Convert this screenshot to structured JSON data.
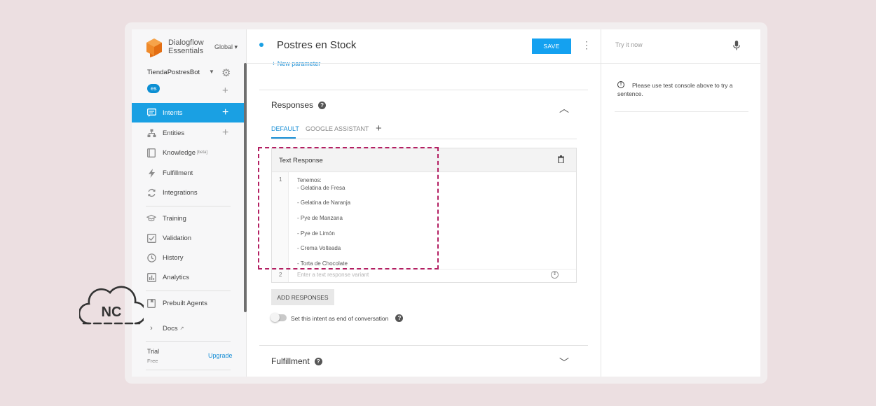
{
  "brand": {
    "name_line1": "Dialogflow",
    "name_line2": "Essentials",
    "region": "Global ▾",
    "accent": "#1aa0e3",
    "highlight": "#b31f62"
  },
  "agent": {
    "name": "TiendaPostresBot",
    "language": "es"
  },
  "sidebar": {
    "items": [
      {
        "label": "Intents",
        "icon": "intents-icon"
      },
      {
        "label": "Entities",
        "icon": "entities-icon"
      },
      {
        "label": "Knowledge",
        "badge": "[beta]",
        "icon": "knowledge-icon"
      },
      {
        "label": "Fulfillment",
        "icon": "fulfillment-icon"
      },
      {
        "label": "Integrations",
        "icon": "integrations-icon"
      },
      {
        "label": "Training",
        "icon": "training-icon"
      },
      {
        "label": "Validation",
        "icon": "validation-icon"
      },
      {
        "label": "History",
        "icon": "history-icon"
      },
      {
        "label": "Analytics",
        "icon": "analytics-icon"
      },
      {
        "label": "Prebuilt Agents",
        "icon": "prebuilt-agents-icon"
      },
      {
        "label": "Docs",
        "icon": "docs-icon"
      }
    ],
    "trial": "Trial",
    "trial_sub": "Free",
    "upgrade": "Upgrade"
  },
  "header": {
    "title": "Postres en Stock",
    "save_label": "SAVE"
  },
  "main": {
    "new_parameter": "+ New parameter",
    "responses_title": "Responses",
    "tabs": [
      "DEFAULT",
      "GOOGLE ASSISTANT"
    ],
    "text_response": {
      "title": "Text Response",
      "line_numbers": [
        "1",
        "2"
      ],
      "lines": [
        "Tenemos:",
        "- Gelatina de Fresa",
        "",
        "- Gelatina de Naranja",
        "",
        "- Pye de Manzana",
        "",
        "- Pye de Limón",
        "",
        "- Crema Volteada",
        "",
        "- Torta de Chocolate"
      ],
      "variant_placeholder": "Enter a text response variant"
    },
    "add_responses": "ADD RESPONSES",
    "end_conversation_label": "Set this intent as end of conversation",
    "fulfillment_title": "Fulfillment"
  },
  "test_console": {
    "placeholder": "Try it now",
    "info": "Please use test console above to try a sentence."
  },
  "watermark": {
    "text": "NC"
  }
}
